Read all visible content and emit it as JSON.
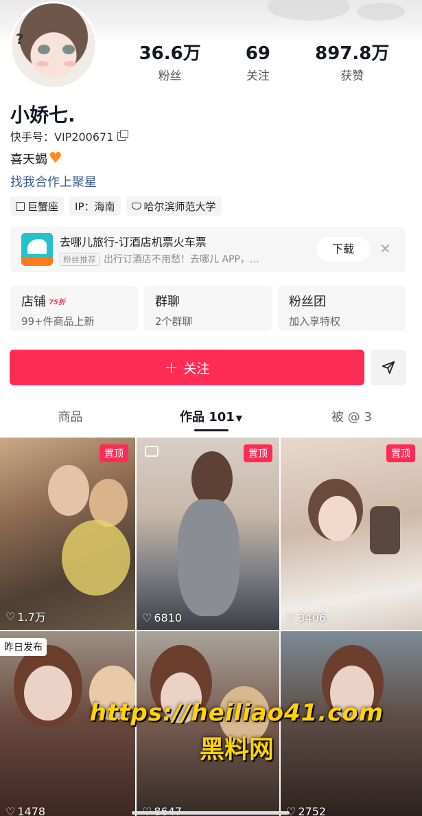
{
  "profile": {
    "nickname": "小娇七.",
    "kuaishou_id": "快手号：VIP200671",
    "bio": "喜天蝎",
    "bio_icon": "orange-heart-icon",
    "link": "找我合作上聚星"
  },
  "stats": [
    {
      "num": "36.6万",
      "label": "粉丝"
    },
    {
      "num": "69",
      "label": "关注"
    },
    {
      "num": "897.8万",
      "label": "获赞"
    }
  ],
  "tags": [
    "巨蟹座",
    "IP：海南",
    "哈尔滨师范大学"
  ],
  "ad": {
    "title": "去哪儿旅行-订酒店机票火车票",
    "badge": "粉丝推荐",
    "subtitle": "出行订酒店不用愁！去哪儿 APP，…",
    "button": "下载",
    "close": "✕",
    "logo_color": "#26c1c9"
  },
  "cards": [
    {
      "title": "店铺",
      "badge": "75折",
      "sub": "99+件商品上新"
    },
    {
      "title": "群聊",
      "badge": "",
      "sub": "2个群聊"
    },
    {
      "title": "粉丝团",
      "badge": "",
      "sub": "加入享特权"
    }
  ],
  "actions": {
    "follow_label": "关注",
    "follow_color": "#fe2c55"
  },
  "tabs": [
    {
      "label": "商品"
    },
    {
      "label": "作品 101"
    },
    {
      "label": "被 @ 3"
    }
  ],
  "videos": [
    {
      "likes": "1.7万",
      "pinned": "置顶",
      "badge": ""
    },
    {
      "likes": "6810",
      "pinned": "置顶",
      "badge": ""
    },
    {
      "likes": "3406",
      "pinned": "置顶",
      "badge": ""
    },
    {
      "likes": "1478",
      "pinned": "",
      "badge": "昨日发布"
    },
    {
      "likes": "8647",
      "pinned": "",
      "badge": ""
    },
    {
      "likes": "2752",
      "pinned": "",
      "badge": ""
    }
  ],
  "watermark": {
    "line1": "https://heiliao41.com",
    "line2": "黑料网"
  }
}
